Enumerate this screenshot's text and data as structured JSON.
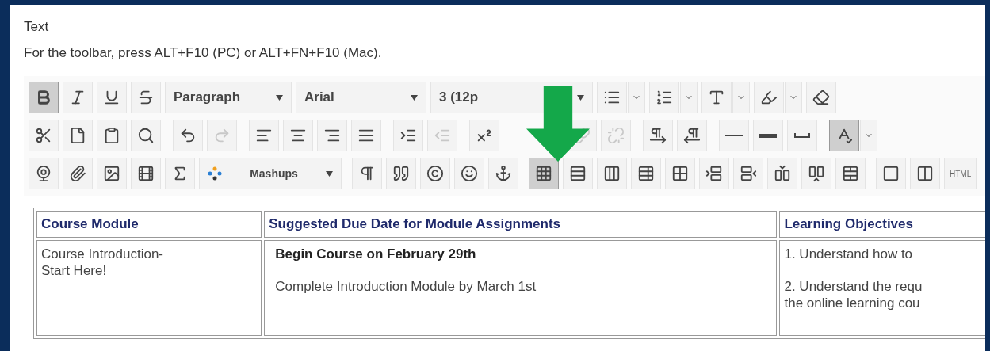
{
  "field_label": "Text",
  "hint": "For the toolbar, press ALT+F10 (PC) or ALT+FN+F10 (Mac).",
  "toolbar": {
    "rows": [
      [
        {
          "kind": "icon",
          "selected": true,
          "disabled": false
        },
        {
          "kind": "icon",
          "selected": false,
          "disabled": false
        },
        {
          "kind": "icon",
          "selected": false,
          "disabled": false
        },
        {
          "kind": "icon",
          "selected": false,
          "disabled": false
        },
        {
          "kind": "select",
          "value": "Paragraph"
        },
        {
          "kind": "select",
          "value": "Arial"
        },
        {
          "kind": "select",
          "value": "3 (12p"
        },
        {
          "kind": "split",
          "selected": false,
          "disabled": false
        },
        {
          "kind": "split",
          "selected": false,
          "disabled": false
        },
        {
          "kind": "split",
          "selected": false,
          "disabled": false
        },
        {
          "kind": "split",
          "selected": false,
          "disabled": false
        },
        {
          "kind": "icon",
          "selected": false,
          "disabled": false
        }
      ],
      [
        {
          "kind": "icon",
          "selected": false,
          "disabled": false
        },
        {
          "kind": "icon",
          "selected": false,
          "disabled": false
        },
        {
          "kind": "icon",
          "selected": false,
          "disabled": false
        },
        {
          "kind": "icon",
          "selected": false,
          "disabled": false
        },
        {
          "kind": "icon",
          "selected": false,
          "disabled": false
        },
        {
          "kind": "icon",
          "selected": false,
          "disabled": true
        },
        {
          "kind": "icon",
          "selected": false,
          "disabled": false
        },
        {
          "kind": "icon",
          "selected": false,
          "disabled": false
        },
        {
          "kind": "icon",
          "selected": false,
          "disabled": false
        },
        {
          "kind": "icon",
          "selected": false,
          "disabled": false
        },
        {
          "kind": "icon",
          "selected": false,
          "disabled": false
        },
        {
          "kind": "icon",
          "selected": false,
          "disabled": true
        },
        {
          "kind": "icon",
          "selected": false,
          "disabled": false
        },
        {
          "kind": "icon",
          "selected": false,
          "disabled": true
        },
        {
          "kind": "icon",
          "selected": false,
          "disabled": true
        },
        {
          "kind": "icon",
          "selected": false,
          "disabled": false
        },
        {
          "kind": "icon",
          "selected": false,
          "disabled": false
        },
        {
          "kind": "icon",
          "selected": false,
          "disabled": false
        },
        {
          "kind": "icon",
          "selected": false,
          "disabled": false
        },
        {
          "kind": "icon",
          "selected": false,
          "disabled": false
        },
        {
          "kind": "split",
          "selected": true,
          "disabled": false
        }
      ],
      [
        {
          "kind": "icon",
          "selected": false,
          "disabled": false
        },
        {
          "kind": "icon",
          "selected": false,
          "disabled": false
        },
        {
          "kind": "icon",
          "selected": false,
          "disabled": false
        },
        {
          "kind": "icon",
          "selected": false,
          "disabled": false
        },
        {
          "kind": "icon",
          "selected": false,
          "disabled": false
        },
        {
          "kind": "menu",
          "label": "Mashups"
        },
        {
          "kind": "icon",
          "selected": false,
          "disabled": false
        },
        {
          "kind": "icon",
          "selected": false,
          "disabled": false
        },
        {
          "kind": "icon",
          "selected": false,
          "disabled": false
        },
        {
          "kind": "icon",
          "selected": false,
          "disabled": false
        },
        {
          "kind": "icon",
          "selected": false,
          "disabled": false
        },
        {
          "kind": "icon",
          "selected": true,
          "disabled": false
        },
        {
          "kind": "icon",
          "selected": false,
          "disabled": false
        },
        {
          "kind": "icon",
          "selected": false,
          "disabled": false
        },
        {
          "kind": "icon",
          "selected": false,
          "disabled": false
        },
        {
          "kind": "icon",
          "selected": false,
          "disabled": false
        },
        {
          "kind": "icon",
          "selected": false,
          "disabled": false
        },
        {
          "kind": "icon",
          "selected": false,
          "disabled": false
        },
        {
          "kind": "icon",
          "selected": false,
          "disabled": false
        },
        {
          "kind": "icon",
          "selected": false,
          "disabled": false
        },
        {
          "kind": "icon",
          "selected": false,
          "disabled": false
        },
        {
          "kind": "icon",
          "selected": false,
          "disabled": false
        },
        {
          "kind": "icon",
          "selected": false,
          "disabled": false
        },
        {
          "kind": "text",
          "label": "HTML"
        }
      ]
    ]
  },
  "table": {
    "columns": [
      "Course Module",
      "Suggested Due Date for Module Assignments",
      "Learning Objectives"
    ],
    "rows": [
      [
        {
          "paragraphs": [
            {
              "lines": [
                "Course Introduction-",
                "Start Here!"
              ],
              "bold": false,
              "cursor": false
            }
          ]
        },
        {
          "paragraphs": [
            {
              "lines": [
                "Begin Course on February 29th"
              ],
              "bold": true,
              "cursor": true
            },
            {
              "lines": [
                "Complete Introduction Module by March 1st"
              ],
              "bold": false,
              "cursor": false
            }
          ]
        },
        {
          "paragraphs": [
            {
              "lines": [
                "1.  Understand how to"
              ],
              "bold": false,
              "cursor": false
            },
            {
              "lines": [
                "2. Understand the requ",
                "the online learning cou"
              ],
              "bold": false,
              "cursor": false
            }
          ]
        }
      ]
    ]
  }
}
